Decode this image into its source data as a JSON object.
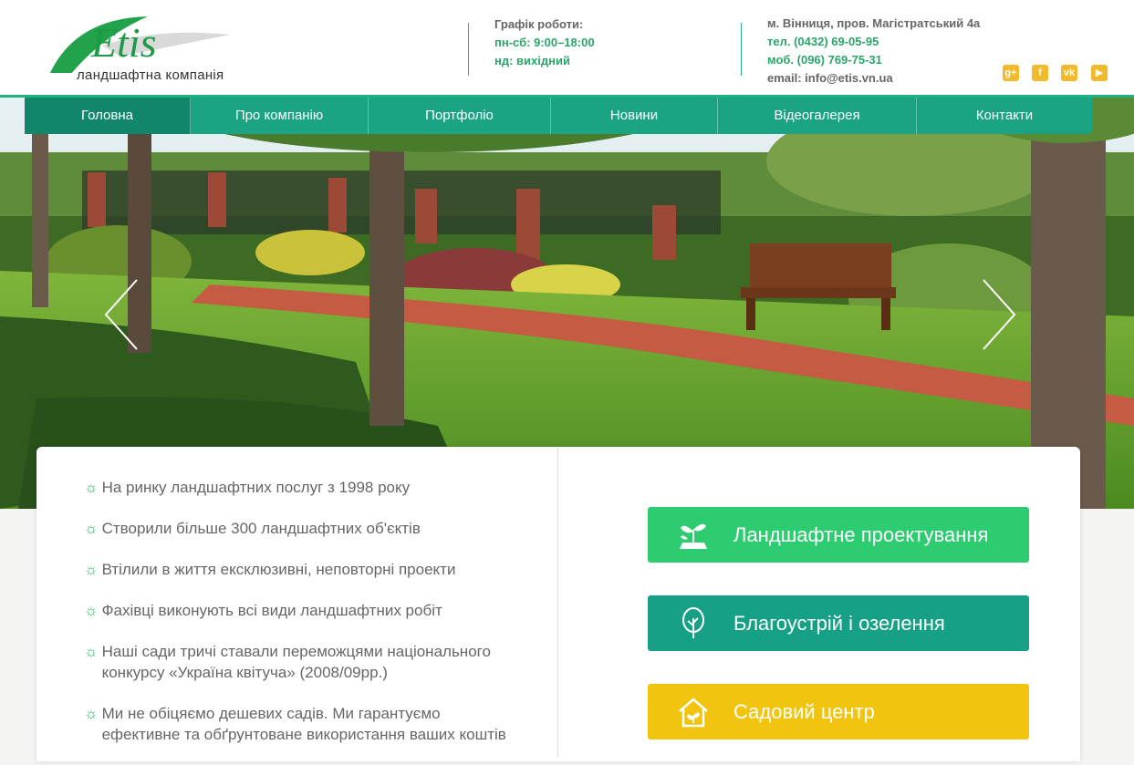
{
  "brand": {
    "logo_text": "Etis",
    "tagline": "ландшафтна компанія"
  },
  "schedule": {
    "title": "Графік роботи:",
    "weekdays": "пн-сб: 9:00–18:00",
    "sunday": "нд: вихідний"
  },
  "contacts": {
    "address": "м. Вінниця, пров. Магістратський 4а",
    "phone": "тел. (0432) 69-05-95",
    "mobile": "моб. (096) 769-75-31",
    "email": "email: info@etis.vn.ua"
  },
  "social": [
    {
      "icon": "google-plus-icon",
      "glyph": "g+"
    },
    {
      "icon": "facebook-icon",
      "glyph": "f"
    },
    {
      "icon": "vk-icon",
      "glyph": "vk"
    },
    {
      "icon": "youtube-icon",
      "glyph": "▶"
    }
  ],
  "nav": {
    "items": [
      {
        "label": "Головна",
        "active": true
      },
      {
        "label": "Про компанію"
      },
      {
        "label": "Портфоліо"
      },
      {
        "label": "Новини"
      },
      {
        "label": "Відеогалерея"
      },
      {
        "label": "Контакти"
      }
    ]
  },
  "features": [
    "На ринку ландшафтних послуг з 1998 року",
    "Створили більше 300 ландшафтних об'єктів",
    "Втілили в життя ексклюзивні, неповторні проекти",
    "Фахівці виконують всі види ландшафтних робіт",
    "Наші сади тричі ставали переможцями національного конкурсу «Україна квітуча» (2008/09рр.)",
    "Ми не обіцяємо дешевих садів. Ми гарантуємо ефективне та обґрунтоване використання ваших коштів"
  ],
  "services": [
    {
      "label": "Ландшафтне проектування",
      "icon": "seedling-icon",
      "color": "#2ecc71"
    },
    {
      "label": "Благоустрій і озелення",
      "icon": "tree-icon",
      "color": "#16a085"
    },
    {
      "label": "Садовий центр",
      "icon": "garden-house-icon",
      "color": "#f1c40f"
    }
  ],
  "colors": {
    "accent": "#1aa483",
    "accent_dark": "#12866a",
    "text_green": "#2aa66a"
  }
}
